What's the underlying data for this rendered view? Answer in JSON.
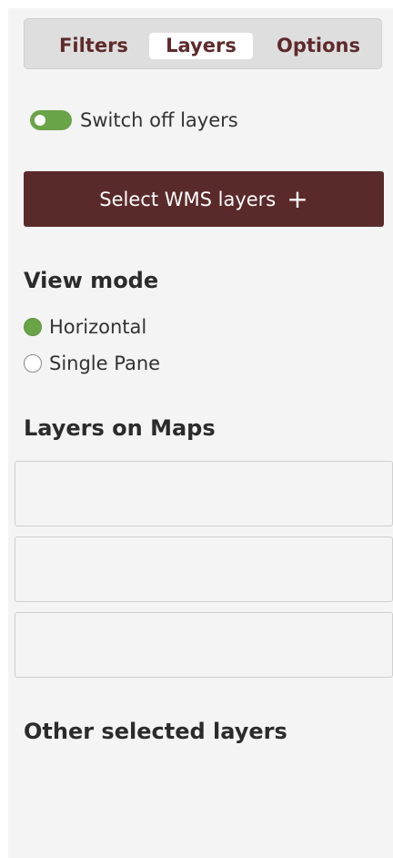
{
  "tabs": {
    "filters": "Filters",
    "layers": "Layers",
    "options": "Options",
    "active": "Layers"
  },
  "toggle": {
    "label": "Switch off layers",
    "on": true,
    "color": "#6aa448"
  },
  "wms_button": {
    "label": "Select WMS layers",
    "icon": "plus-icon",
    "icon_glyph": "+",
    "color": "#5a2a2b"
  },
  "view_mode": {
    "title": "View mode",
    "options": [
      {
        "label": "Horizontal",
        "selected": true
      },
      {
        "label": "Single Pane",
        "selected": false
      }
    ]
  },
  "layers_on_maps": {
    "title": "Layers on Maps",
    "boxes": [
      "",
      "",
      ""
    ]
  },
  "other_selected": {
    "title": "Other selected layers"
  }
}
